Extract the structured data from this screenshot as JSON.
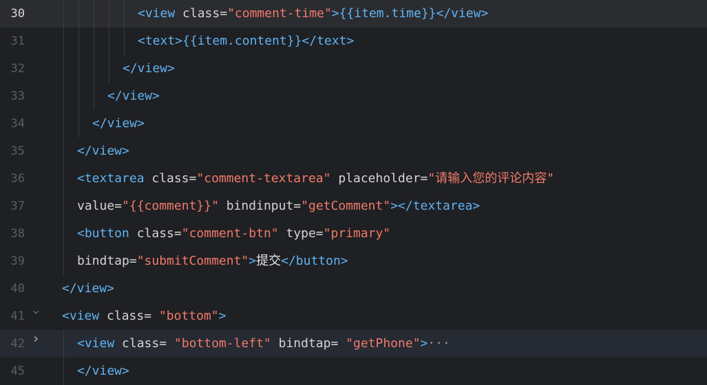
{
  "editor": {
    "lines": [
      {
        "num": "30",
        "active": true,
        "indent": 200,
        "tokens": [
          {
            "t": "tag",
            "v": "<view "
          },
          {
            "t": "attr",
            "v": "class="
          },
          {
            "t": "str",
            "v": "\"comment-time\""
          },
          {
            "t": "tag",
            "v": ">{{item.time}}"
          },
          {
            "t": "tag",
            "v": "</view>"
          }
        ]
      },
      {
        "num": "31",
        "indent": 200,
        "tokens": [
          {
            "t": "tag",
            "v": "<text>"
          },
          {
            "t": "tag",
            "v": "{{item.content}}"
          },
          {
            "t": "tag",
            "v": "</text>"
          }
        ]
      },
      {
        "num": "32",
        "indent": 178,
        "tokens": [
          {
            "t": "tag",
            "v": "</view>"
          }
        ]
      },
      {
        "num": "33",
        "indent": 156,
        "tokens": [
          {
            "t": "tag",
            "v": "</view>"
          }
        ]
      },
      {
        "num": "34",
        "indent": 134,
        "tokens": [
          {
            "t": "tag",
            "v": "</view>"
          }
        ]
      },
      {
        "num": "35",
        "indent": 112,
        "tokens": [
          {
            "t": "tag",
            "v": "</view>"
          }
        ]
      },
      {
        "num": "36",
        "indent": 112,
        "tokens": [
          {
            "t": "tag",
            "v": "<textarea "
          },
          {
            "t": "attr",
            "v": "class="
          },
          {
            "t": "str",
            "v": "\"comment-textarea\""
          },
          {
            "t": "attr",
            "v": " placeholder="
          },
          {
            "t": "str",
            "v": "\"请输入您的评论内容\""
          }
        ]
      },
      {
        "num": "37",
        "indent": 112,
        "tokens": [
          {
            "t": "attr",
            "v": "value="
          },
          {
            "t": "str",
            "v": "\"{{comment}}\""
          },
          {
            "t": "attr",
            "v": " bindinput="
          },
          {
            "t": "str",
            "v": "\"getComment\""
          },
          {
            "t": "tag",
            "v": "></textarea>"
          }
        ]
      },
      {
        "num": "38",
        "indent": 112,
        "tokens": [
          {
            "t": "tag",
            "v": "<button "
          },
          {
            "t": "attr",
            "v": "class="
          },
          {
            "t": "str",
            "v": "\"comment-btn\""
          },
          {
            "t": "attr",
            "v": " type="
          },
          {
            "t": "str",
            "v": "\"primary\""
          }
        ]
      },
      {
        "num": "39",
        "indent": 112,
        "tokens": [
          {
            "t": "attr",
            "v": "bindtap="
          },
          {
            "t": "str",
            "v": "\"submitComment\""
          },
          {
            "t": "tag",
            "v": ">"
          },
          {
            "t": "txt",
            "v": "提交"
          },
          {
            "t": "tag",
            "v": "</button>"
          }
        ]
      },
      {
        "num": "40",
        "indent": 90,
        "tokens": [
          {
            "t": "tag",
            "v": "</view>"
          }
        ]
      },
      {
        "num": "41",
        "indent": 90,
        "fold": "expanded",
        "tokens": [
          {
            "t": "tag",
            "v": "<view "
          },
          {
            "t": "attr",
            "v": "class= "
          },
          {
            "t": "str",
            "v": "\"bottom\""
          },
          {
            "t": "tag",
            "v": ">"
          }
        ]
      },
      {
        "num": "42",
        "indent": 112,
        "fold": "collapsed",
        "highlight": true,
        "tokens": [
          {
            "t": "tag",
            "v": "<view "
          },
          {
            "t": "attr",
            "v": "class= "
          },
          {
            "t": "str",
            "v": "\"bottom-left\""
          },
          {
            "t": "attr",
            "v": " bindtap= "
          },
          {
            "t": "str",
            "v": "\"getPhone\""
          },
          {
            "t": "tag",
            "v": ">"
          },
          {
            "t": "ell",
            "v": "···"
          }
        ]
      },
      {
        "num": "45",
        "indent": 112,
        "tokens": [
          {
            "t": "tag",
            "v": "</view>"
          }
        ]
      }
    ],
    "icons": {
      "fold_expanded": "chevron-down-icon",
      "fold_collapsed": "chevron-right-icon"
    },
    "colors": {
      "background": "#1f2023",
      "tag": "#5fb3f3",
      "string": "#f07a6a",
      "attribute": "#d4d4d4",
      "line_number": "#5a5d63"
    }
  }
}
